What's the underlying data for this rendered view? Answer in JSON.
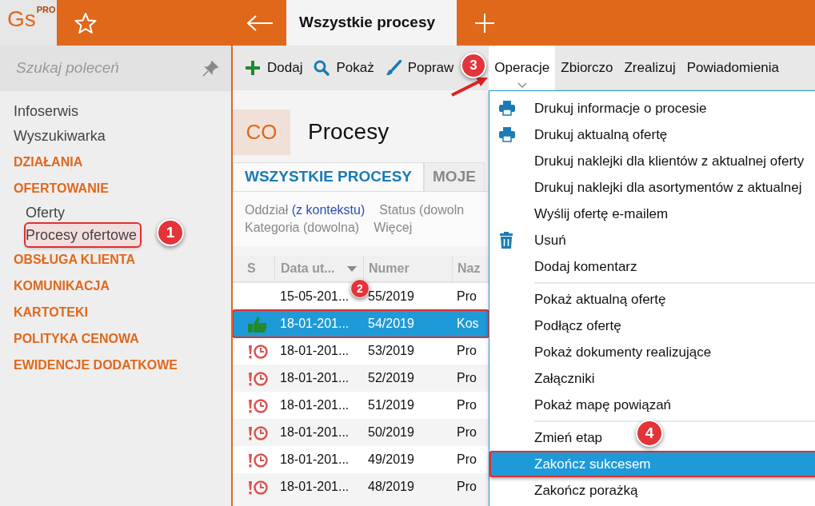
{
  "app": {
    "logo": "Gs",
    "logo_badge": "PRO"
  },
  "search": {
    "placeholder": "Szukaj poleceń"
  },
  "sidebar": {
    "items": [
      {
        "label": "Infoserwis",
        "kind": "link",
        "selected": false
      },
      {
        "label": "Wyszukiwarka",
        "kind": "link",
        "selected": false
      },
      {
        "label": "DZIAŁANIA",
        "kind": "section",
        "selected": false
      },
      {
        "label": "OFERTOWANIE",
        "kind": "section",
        "selected": false,
        "children": [
          {
            "label": "Oferty",
            "kind": "link",
            "selected": false
          },
          {
            "label": "Procesy ofertowe",
            "kind": "link",
            "selected": true
          }
        ]
      },
      {
        "label": "OBSŁUGA KLIENTA",
        "kind": "section",
        "selected": false
      },
      {
        "label": "KOMUNIKACJA",
        "kind": "section",
        "selected": false
      },
      {
        "label": "KARTOTEKI",
        "kind": "section",
        "selected": false
      },
      {
        "label": "POLITYKA CENOWA",
        "kind": "section",
        "selected": false
      },
      {
        "label": "EWIDENCJE DODATKOWE",
        "kind": "section",
        "selected": false
      }
    ]
  },
  "window_tabs": [
    {
      "label": "Wszystkie procesy",
      "selected": true
    }
  ],
  "toolbar": [
    {
      "label": "Dodaj",
      "kind": "add",
      "selected": false
    },
    {
      "label": "Pokaż",
      "kind": "show",
      "selected": false
    },
    {
      "label": "Popraw",
      "kind": "edit",
      "selected": false
    },
    {
      "label": "Operacje",
      "kind": "menu",
      "selected": true
    },
    {
      "label": "Zbiorczo",
      "kind": "menu",
      "selected": false
    },
    {
      "label": "Zrealizuj",
      "kind": "menu",
      "selected": false
    },
    {
      "label": "Powiadomienia",
      "kind": "menu",
      "selected": false
    }
  ],
  "header": {
    "badge": "CO",
    "title": "Procesy"
  },
  "view_tabs": [
    {
      "label": "WSZYSTKIE PROCESY",
      "selected": true
    },
    {
      "label": "MOJE",
      "selected": false
    }
  ],
  "filters": [
    [
      {
        "label": "Oddział",
        "value": "(z kontekstu)"
      },
      {
        "label": "Status (dowoln"
      }
    ],
    [
      {
        "label": "Kategoria (dowolna)"
      },
      {
        "label": "Więcej"
      }
    ]
  ],
  "table": {
    "columns": [
      {
        "label": "S",
        "sorted": false
      },
      {
        "label": "Data ut...",
        "sorted": true
      },
      {
        "label": "Numer",
        "sorted": false
      },
      {
        "label": "Naz",
        "sorted": false
      }
    ],
    "rows": [
      {
        "kind": "none",
        "date": "15-05-201...",
        "number": "55/2019",
        "name": "Pro",
        "selected": false
      },
      {
        "kind": "success",
        "date": "18-01-201...",
        "number": "54/2019",
        "name": "Kos",
        "selected": true
      },
      {
        "kind": "overdue",
        "date": "18-01-201...",
        "number": "53/2019",
        "name": "Pro",
        "selected": false
      },
      {
        "kind": "overdue",
        "date": "18-01-201...",
        "number": "52/2019",
        "name": "Pro",
        "selected": false
      },
      {
        "kind": "overdue",
        "date": "18-01-201...",
        "number": "51/2019",
        "name": "Pro",
        "selected": false
      },
      {
        "kind": "overdue",
        "date": "18-01-201...",
        "number": "50/2019",
        "name": "Pro",
        "selected": false
      },
      {
        "kind": "overdue",
        "date": "18-01-201...",
        "number": "49/2019",
        "name": "Pro",
        "selected": false
      },
      {
        "kind": "overdue",
        "date": "18-01-201...",
        "number": "48/2019",
        "name": "Pro",
        "selected": false
      }
    ]
  },
  "menu": {
    "groups": [
      [
        {
          "label": "Drukuj informacje o procesie",
          "kind": "print",
          "selected": false
        },
        {
          "label": "Drukuj aktualną ofertę",
          "kind": "print",
          "selected": false
        },
        {
          "label": "Drukuj naklejki dla klientów z aktualnej oferty",
          "kind": "plain",
          "selected": false
        },
        {
          "label": "Drukuj naklejki dla asortymentów z aktualnej",
          "kind": "plain",
          "selected": false
        },
        {
          "label": "Wyślij ofertę e-mailem",
          "kind": "plain",
          "selected": false
        },
        {
          "label": "Usuń",
          "kind": "delete",
          "selected": false
        },
        {
          "label": "Dodaj komentarz",
          "kind": "plain",
          "selected": false
        }
      ],
      [
        {
          "label": "Pokaż aktualną ofertę",
          "kind": "plain",
          "selected": false
        },
        {
          "label": "Podłącz ofertę",
          "kind": "plain",
          "selected": false
        },
        {
          "label": "Pokaż dokumenty realizujące",
          "kind": "plain",
          "selected": false
        },
        {
          "label": "Załączniki",
          "kind": "plain",
          "selected": false
        },
        {
          "label": "Pokaż mapę powiązań",
          "kind": "plain",
          "selected": false
        }
      ],
      [
        {
          "label": "Zmień etap",
          "kind": "plain",
          "selected": false
        },
        {
          "label": "Zakończ sukcesem",
          "kind": "plain",
          "selected": true
        },
        {
          "label": "Zakończ porażką",
          "kind": "plain",
          "selected": false
        }
      ]
    ]
  },
  "annotations": [
    {
      "label": "1"
    },
    {
      "label": "2"
    },
    {
      "label": "3"
    },
    {
      "label": "4"
    }
  ]
}
